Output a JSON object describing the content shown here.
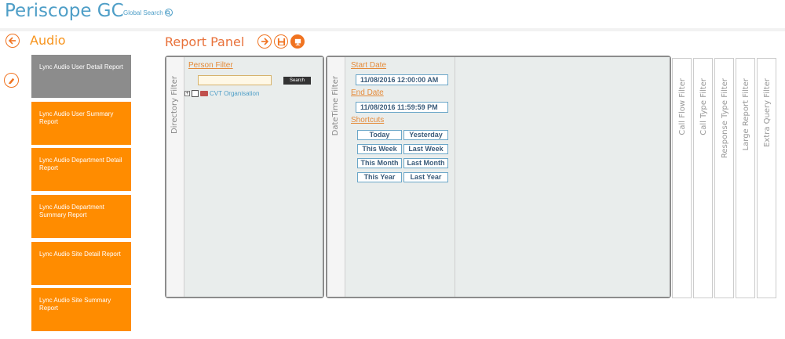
{
  "header": {
    "app_title": "Periscope GC",
    "global_search_label": "Global Search"
  },
  "sidebar": {
    "section_title": "Audio",
    "reports": [
      {
        "label": "Lync Audio User Detail Report",
        "selected": true
      },
      {
        "label": "Lync Audio User Summary Report",
        "selected": false
      },
      {
        "label": "Lync Audio Department Detail Report",
        "selected": false
      },
      {
        "label": "Lync Audio Department Summary Report",
        "selected": false
      },
      {
        "label": "Lync Audio Site Detail Report",
        "selected": false
      },
      {
        "label": "Lync Audio Site Summary Report",
        "selected": false
      }
    ]
  },
  "panel": {
    "title": "Report Panel",
    "buttons": [
      "arrow-right-icon",
      "save-icon",
      "export-icon"
    ],
    "directory_filter": {
      "tab_label": "Directory Filter",
      "person_filter_label": "Person Filter",
      "search_value": "",
      "search_button": "Search",
      "tree_node": "CVT Organisation"
    },
    "datetime_filter": {
      "tab_label": "DateTime Filter",
      "start_date_label": "Start Date",
      "start_date_value": "11/08/2016 12:00:00 AM",
      "end_date_label": "End Date",
      "end_date_value": "11/08/2016 11:59:59 PM",
      "shortcuts_label": "Shortcuts",
      "shortcuts": [
        "Today",
        "Yesterday",
        "This Week",
        "Last Week",
        "This Month",
        "Last Month",
        "This Year",
        "Last Year"
      ]
    },
    "side_tabs": [
      "Call Flow Filter",
      "Call Type Filter",
      "Response Type Filter",
      "Large Report Filter",
      "Extra Query Filter"
    ]
  },
  "colors": {
    "accent_blue": "#4e9ec7",
    "accent_orange": "#ff8c00",
    "selected_tile": "#8c8c8c"
  }
}
